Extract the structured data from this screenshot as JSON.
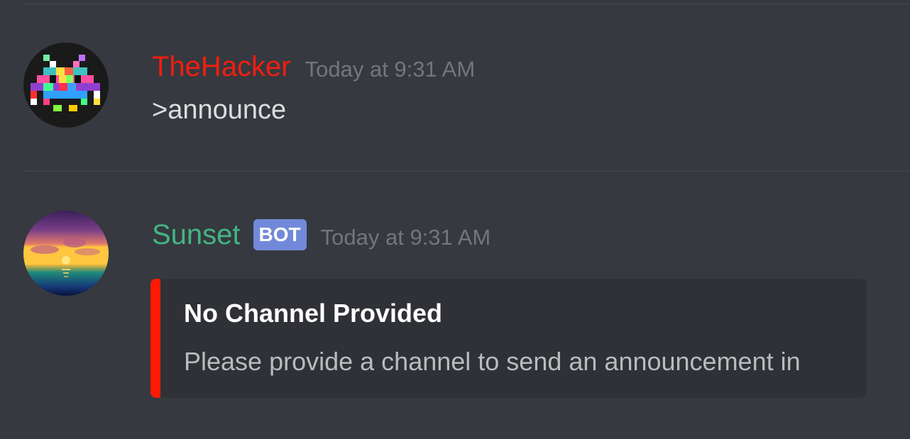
{
  "colors": {
    "background": "#36393f",
    "embed_background": "#2f3136",
    "embed_accent": "#ff1a05",
    "bot_tag": "#7289da",
    "timestamp": "#72767d"
  },
  "messages": [
    {
      "author": "TheHacker",
      "author_color": "#f21e0f",
      "avatar_icon": "space-invader-rainbow-icon",
      "timestamp": "Today at 9:31 AM",
      "content": ">announce"
    },
    {
      "author": "Sunset",
      "author_color": "#43b581",
      "avatar_icon": "sunset-ocean-icon",
      "bot_tag": "BOT",
      "timestamp": "Today at 9:31 AM",
      "embed": {
        "title": "No Channel Provided",
        "description": "Please provide a channel to send an announcement in"
      }
    }
  ]
}
